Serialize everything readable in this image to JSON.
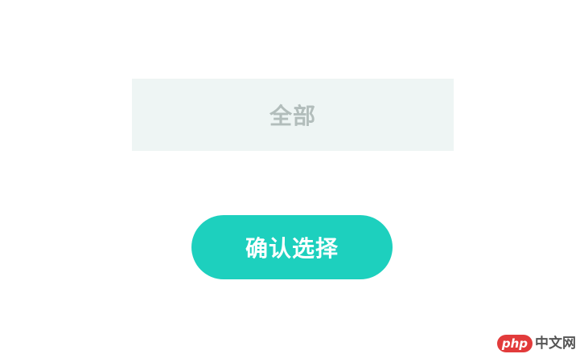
{
  "filter": {
    "option_label": "全部"
  },
  "actions": {
    "confirm_label": "确认选择"
  },
  "watermark": {
    "badge": "php",
    "text": "中文网"
  },
  "colors": {
    "option_bg": "#eef5f4",
    "option_text": "#b2bdbb",
    "accent": "#1dd0be",
    "button_text": "#ffffff",
    "watermark_red": "#e23b3b"
  }
}
